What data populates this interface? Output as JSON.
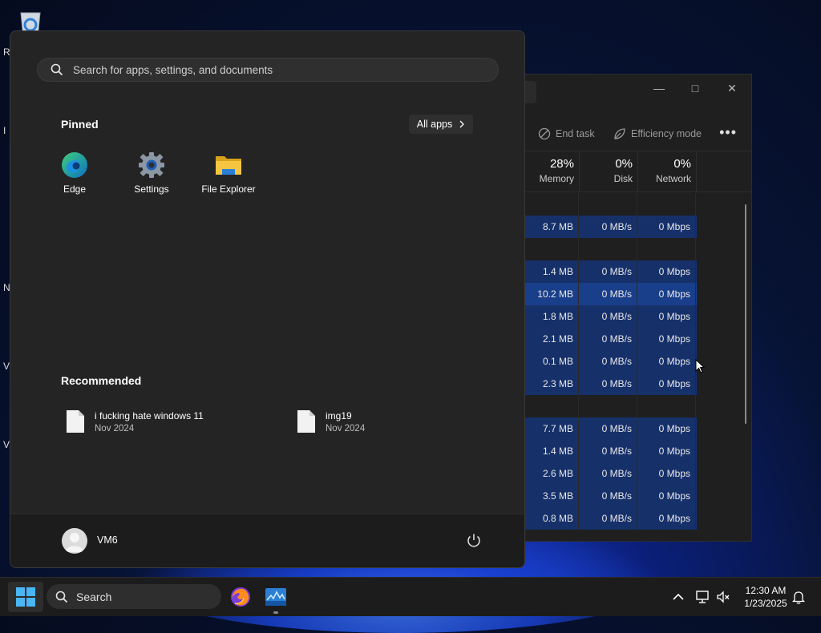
{
  "start_menu": {
    "search_placeholder": "Search for apps, settings, and documents",
    "pinned_title": "Pinned",
    "all_apps_label": "All apps",
    "pinned_apps": [
      {
        "label": "Edge",
        "icon": "edge-icon"
      },
      {
        "label": "Settings",
        "icon": "settings-gear-icon"
      },
      {
        "label": "File Explorer",
        "icon": "folder-icon"
      }
    ],
    "recommended_title": "Recommended",
    "recommended": [
      {
        "name": "i fucking hate windows 11",
        "date": "Nov 2024",
        "icon": "document-icon"
      },
      {
        "name": "img19",
        "date": "Nov 2024",
        "icon": "document-icon"
      }
    ],
    "user_name": "VM6"
  },
  "task_manager": {
    "toolbar": {
      "end_task": "End task",
      "efficiency_mode": "Efficiency mode"
    },
    "columns": [
      {
        "percent": "28%",
        "name": "Memory"
      },
      {
        "percent": "0%",
        "name": "Disk"
      },
      {
        "percent": "0%",
        "name": "Network"
      }
    ],
    "rows": [
      {
        "memory": "",
        "disk": "",
        "network": "",
        "highlight": false
      },
      {
        "memory": "8.7 MB",
        "disk": "0 MB/s",
        "network": "0 Mbps",
        "highlight": true
      },
      {
        "memory": "",
        "disk": "",
        "network": "",
        "highlight": false
      },
      {
        "memory": "1.4 MB",
        "disk": "0 MB/s",
        "network": "0 Mbps",
        "highlight": true
      },
      {
        "memory": "10.2 MB",
        "disk": "0 MB/s",
        "network": "0 Mbps",
        "highlight": true
      },
      {
        "memory": "1.8 MB",
        "disk": "0 MB/s",
        "network": "0 Mbps",
        "highlight": true
      },
      {
        "memory": "2.1 MB",
        "disk": "0 MB/s",
        "network": "0 Mbps",
        "highlight": true
      },
      {
        "memory": "0.1 MB",
        "disk": "0 MB/s",
        "network": "0 Mbps",
        "highlight": true
      },
      {
        "memory": "2.3 MB",
        "disk": "0 MB/s",
        "network": "0 Mbps",
        "highlight": true
      },
      {
        "memory": "",
        "disk": "",
        "network": "",
        "highlight": false
      },
      {
        "memory": "7.7 MB",
        "disk": "0 MB/s",
        "network": "0 Mbps",
        "highlight": true
      },
      {
        "memory": "1.4 MB",
        "disk": "0 MB/s",
        "network": "0 Mbps",
        "highlight": true
      },
      {
        "memory": "2.6 MB",
        "disk": "0 MB/s",
        "network": "0 Mbps",
        "highlight": true
      },
      {
        "memory": "3.5 MB",
        "disk": "0 MB/s",
        "network": "0 Mbps",
        "highlight": true
      },
      {
        "memory": "0.8 MB",
        "disk": "0 MB/s",
        "network": "0 Mbps",
        "highlight": true
      }
    ]
  },
  "taskbar": {
    "search_label": "Search",
    "time": "12:30 AM",
    "date": "1/23/2025"
  },
  "colors": {
    "row_highlight": "#16306a",
    "row_highlight_alt": "#1a3f8a",
    "accent": "#0078d4"
  }
}
